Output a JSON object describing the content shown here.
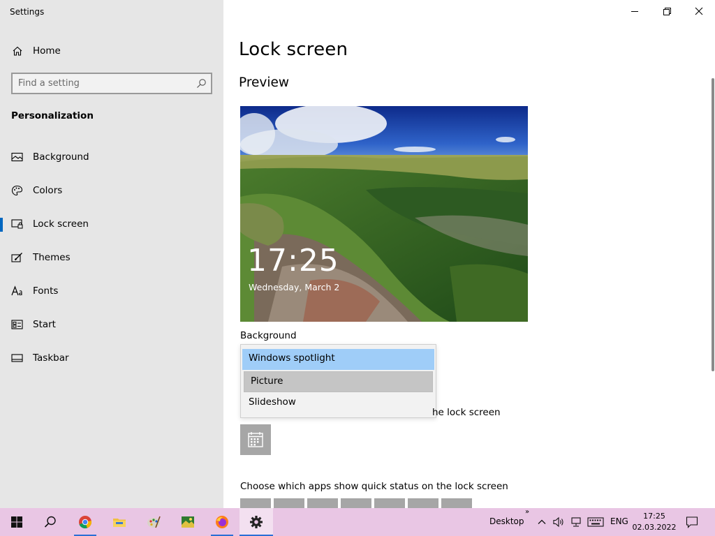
{
  "window": {
    "title": "Settings"
  },
  "sidebar": {
    "home_label": "Home",
    "search_placeholder": "Find a setting",
    "section_title": "Personalization",
    "items": [
      {
        "label": "Background",
        "icon": "image-icon"
      },
      {
        "label": "Colors",
        "icon": "palette-icon"
      },
      {
        "label": "Lock screen",
        "icon": "lock-screen-icon",
        "selected": true
      },
      {
        "label": "Themes",
        "icon": "brush-icon"
      },
      {
        "label": "Fonts",
        "icon": "font-icon"
      },
      {
        "label": "Start",
        "icon": "start-icon"
      },
      {
        "label": "Taskbar",
        "icon": "taskbar-icon"
      }
    ]
  },
  "main": {
    "title": "Lock screen",
    "preview_title": "Preview",
    "preview_time": "17:25",
    "preview_date": "Wednesday, March 2",
    "background_label": "Background",
    "background_options": [
      "Windows spotlight",
      "Picture",
      "Slideshow"
    ],
    "detailed_status_tail": "he lock screen",
    "quick_status_label": "Choose which apps show quick status on the lock screen"
  },
  "taskbar": {
    "desktop_label": "Desktop",
    "language": "ENG",
    "time": "17:25",
    "date": "02.03.2022"
  },
  "colors": {
    "accent": "#0067c0",
    "sidebar_bg": "#e6e6e6",
    "taskbar_bg": "#e9c6e4",
    "dropdown_highlight": "#9fcdf8"
  }
}
